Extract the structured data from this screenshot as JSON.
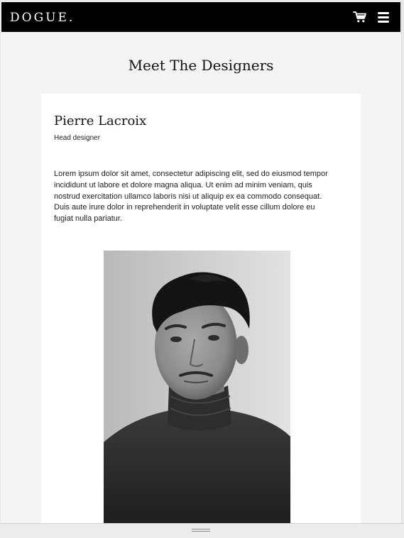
{
  "navbar": {
    "logo": "DOGUE.",
    "icons": [
      "cart-icon",
      "menu-icon"
    ]
  },
  "page": {
    "title": "Meet The Designers"
  },
  "designer": {
    "name": "Pierre Lacroix",
    "role": "Head designer",
    "bio": "Lorem ipsum dolor sit amet, consectetur adipiscing elit, sed do eiusmod tempor incididunt ut labore et dolore magna aliqua. Ut enim ad minim veniam, quis nostrud exercitation ullamco laboris nisi ut aliquip ex ea commodo consequat. Duis aute irure dolor in reprehenderit in voluptate velit esse cillum dolore eu fugiat nulla pariatur."
  },
  "colors": {
    "navbar": "#000000",
    "page_background": "#f4f4f4",
    "card": "#ffffff",
    "text": "#111111"
  }
}
